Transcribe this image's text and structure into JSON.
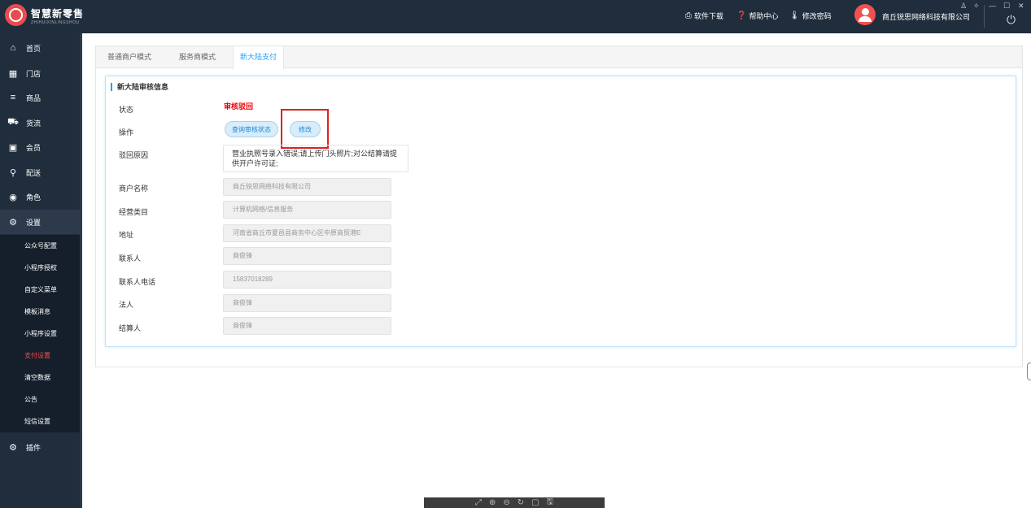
{
  "header": {
    "brand_name": "智慧新零售",
    "brand_sub": "ZHIHUIXINLINGSHOU",
    "links": [
      {
        "icon": "printer-icon",
        "glyph": "⎙",
        "label": "软件下载"
      },
      {
        "icon": "help-icon",
        "glyph": "❓",
        "label": "帮助中心"
      },
      {
        "icon": "thermometer-icon",
        "glyph": "🌡",
        "label": "修改密码"
      }
    ],
    "company": "商丘锐思网络科技有限公司"
  },
  "sidebar": {
    "items": [
      {
        "icon": "home-icon",
        "glyph": "⌂",
        "label": "首页"
      },
      {
        "icon": "store-icon",
        "glyph": "▦",
        "label": "门店"
      },
      {
        "icon": "menu-icon",
        "glyph": "≡",
        "label": "商品"
      },
      {
        "icon": "truck-icon",
        "glyph": "⛟",
        "label": "货流"
      },
      {
        "icon": "member-card-icon",
        "glyph": "▣",
        "label": "会员"
      },
      {
        "icon": "motorcycle-icon",
        "glyph": "⚲",
        "label": "配送"
      },
      {
        "icon": "user-circle-icon",
        "glyph": "◉",
        "label": "角色"
      },
      {
        "icon": "gear-icon",
        "glyph": "⚙",
        "label": "设置"
      }
    ],
    "sub_items": [
      "公众号配置",
      "小程序授权",
      "自定义菜单",
      "模板消息",
      "小程序设置",
      "支付设置",
      "清空数据",
      "公告",
      "短信设置"
    ],
    "active_sub": "支付设置",
    "plugins": {
      "icon": "gears-icon",
      "glyph": "⚙",
      "label": "插件"
    }
  },
  "tabs": [
    {
      "label": "普通商户模式"
    },
    {
      "label": "服务商模式"
    },
    {
      "label": "新大陆支付"
    }
  ],
  "card": {
    "title": "新大陆审核信息",
    "status_label": "状态",
    "status_value": "审核驳回",
    "action_label": "操作",
    "btn_query": "查询审核状态",
    "btn_modify": "修改",
    "reason_label": "驳回原因",
    "reason_value": "营业执照号录入错误;请上传门头照片;对公结算请提供开户许可证;",
    "fields": [
      {
        "label": "商户名称",
        "value": "商丘锐思网络科技有限公司"
      },
      {
        "label": "经营类目",
        "value": "计算机网络/信息服务"
      },
      {
        "label": "地址",
        "value": "河南省商丘市夏邑县商务中心区中原商贸港E"
      },
      {
        "label": "联系人",
        "value": "商俊锋"
      },
      {
        "label": "联系人电话",
        "value": "15837018289"
      },
      {
        "label": "法人",
        "value": "商俊锋"
      },
      {
        "label": "结算人",
        "value": "商俊锋"
      }
    ]
  },
  "colors": {
    "sidebar_bg": "#1f2d3d",
    "accent": "#1e9fff",
    "danger": "#e00000"
  }
}
